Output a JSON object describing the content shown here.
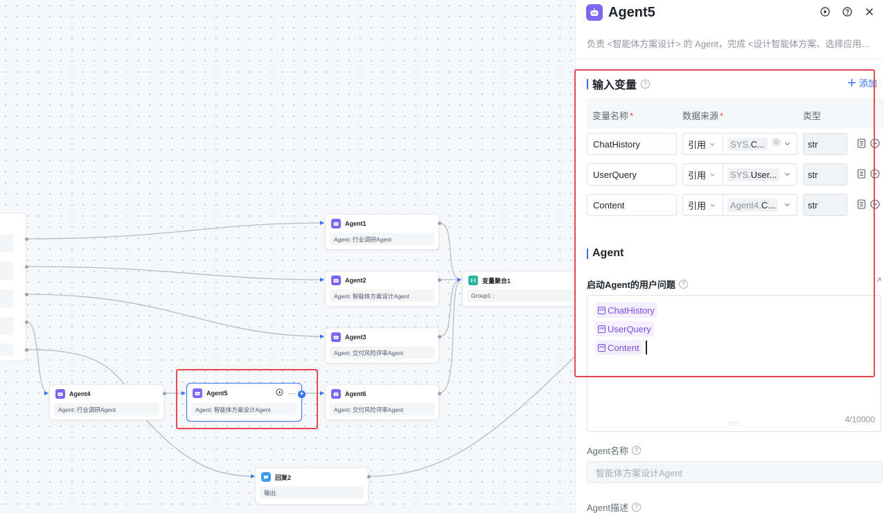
{
  "canvas": {
    "nodes": [
      {
        "id": "agent1",
        "title": "Agent1",
        "body": "Agent: 行业调研Agent"
      },
      {
        "id": "agent2",
        "title": "Agent2",
        "body": "Agent: 智能体方案设计Agent"
      },
      {
        "id": "agent3",
        "title": "Agent3",
        "body": "Agent: 交付风险评审Agent"
      },
      {
        "id": "agent4",
        "title": "Agent4",
        "body": "Agent: 行业调研Agent"
      },
      {
        "id": "agent5",
        "title": "Agent5",
        "body": "Agent: 智能体方案设计Agent",
        "more": "···"
      },
      {
        "id": "agent6",
        "title": "Agent6",
        "body": "Agent: 交付风险评审Agent"
      },
      {
        "id": "merge",
        "title": "变量聚合1",
        "body": "Group1 :"
      },
      {
        "id": "reply",
        "title": "回复2",
        "body": "输出:"
      }
    ]
  },
  "panel": {
    "title": "Agent5",
    "description": "负责 <智能体方案设计> 的 Agent，完成 <设计智能体方案、选择应用模式、定义输入输出变量>",
    "input_section": {
      "title": "输入变量",
      "add_label": "添加",
      "columns": {
        "name": "变量名称",
        "source": "数据来源",
        "type": "类型",
        "required_mark": "*"
      },
      "rows": [
        {
          "name": "ChatHistory",
          "ref": "引用",
          "var_prefix": "SYS.",
          "var_rest": "C...",
          "has_gear": true,
          "type": "str"
        },
        {
          "name": "UserQuery",
          "ref": "引用",
          "var_prefix": "SYS.",
          "var_rest": "User...",
          "has_gear": false,
          "type": "str"
        },
        {
          "name": "Content",
          "ref": "引用",
          "var_prefix": "Agent4.",
          "var_rest": "C...",
          "has_gear": false,
          "type": "str"
        }
      ]
    },
    "agent_section": {
      "title": "Agent",
      "query_label": "启动Agent的用户问题",
      "chips": [
        "ChatHistory",
        "UserQuery",
        "Content"
      ],
      "chip_icon_text": "VAR",
      "counter": "4/10000",
      "grip": "::::",
      "name_label": "Agent名称",
      "name_placeholder": "智能体方案设计Agent",
      "desc_label": "Agent描述"
    }
  }
}
